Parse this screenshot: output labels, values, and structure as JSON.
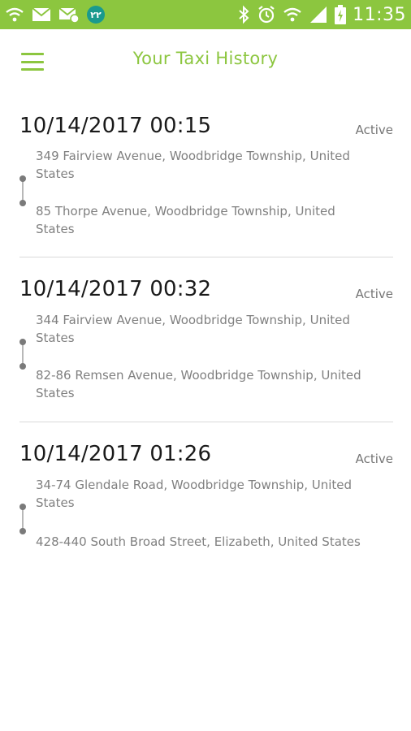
{
  "status_bar": {
    "badge": "٢٢",
    "time": "11:35",
    "color": "#8cc63f"
  },
  "header": {
    "title": "Your Taxi History",
    "accent_color": "#8cc63f"
  },
  "trips": [
    {
      "datetime": "10/14/2017 00:15",
      "status": "Active",
      "from": "349 Fairview Avenue, Woodbridge Township, United States",
      "to": "85 Thorpe Avenue, Woodbridge Township, United States"
    },
    {
      "datetime": "10/14/2017 00:32",
      "status": "Active",
      "from": "344 Fairview Avenue, Woodbridge Township, United States",
      "to": "82-86 Remsen Avenue, Woodbridge Township, United States"
    },
    {
      "datetime": "10/14/2017 01:26",
      "status": "Active",
      "from": "34-74 Glendale Road, Woodbridge Township, United States",
      "to": "428-440 South Broad Street, Elizabeth, United States"
    }
  ]
}
